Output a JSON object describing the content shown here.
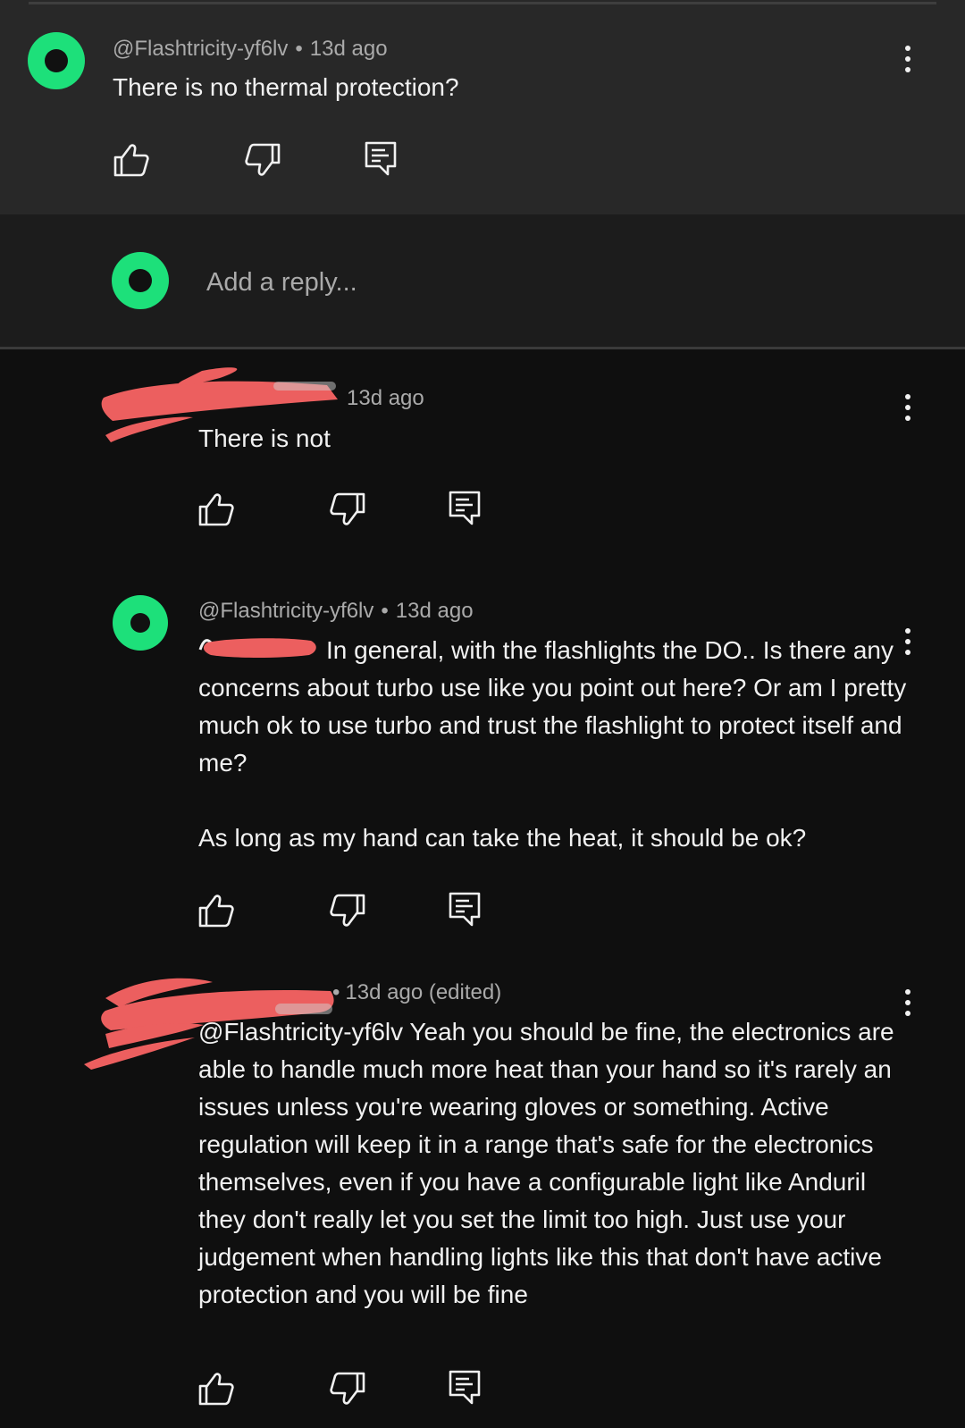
{
  "top_comment": {
    "handle": "@Flashtricity-yf6lv",
    "time": "13d ago",
    "text": "There is no thermal protection?"
  },
  "reply_box": {
    "placeholder": "Add a reply..."
  },
  "replies": [
    {
      "time": "13d ago",
      "paragraphs": [
        "There is not"
      ]
    },
    {
      "handle": "@Flashtricity-yf6lv",
      "time": "13d ago",
      "paragraphs": [
        "In general, with the flashlights the DO.. Is there any concerns about turbo use like you point out here? Or am I pretty much ok to use turbo and trust the flashlight to protect itself and me?",
        "As long as my hand can take the heat, it should be ok?"
      ]
    },
    {
      "time": "13d ago (edited)",
      "paragraphs": [
        "@Flashtricity-yf6lv Yeah you should be fine, the electronics are able to handle much more heat than your hand so it's rarely an issues unless you're wearing gloves or something. Active regulation will keep it in a range that's safe for the electronics themselves, even if you have a configurable light like Anduril they don't really let you set the limit too high. Just use your judgement when handling lights like this that don't have active protection and you will be fine"
      ]
    }
  ],
  "meta_separator": "•",
  "icons": [
    "like-icon",
    "dislike-icon",
    "reply-icon",
    "more-icon"
  ],
  "colors": {
    "avatar": "#1de07a",
    "redaction": "#ec5f5f",
    "panel": "#282828",
    "background": "#0f0f0f"
  }
}
